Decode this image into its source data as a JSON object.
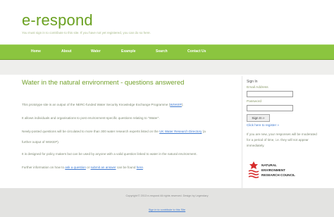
{
  "header": {
    "title": "e-respond",
    "tagline": "You must sign in to contribute to this site. If you have not yet registered, you can do so here."
  },
  "nav": {
    "items": [
      {
        "label": "Home"
      },
      {
        "label": "About"
      },
      {
        "label": "Water"
      },
      {
        "label": "Example"
      },
      {
        "label": "Search"
      },
      {
        "label": "Contact Us"
      }
    ]
  },
  "main": {
    "title": "Water in the natural environment - questions answered",
    "p1_text": "This prototype site is an output of the NERC-funded Water Security Knowledge Exchange Programme (",
    "p1_link": "WSKEP",
    "p1_end": ").",
    "p2": "It allows individuals and organisations to post environment-specific questions relating to \"Water\".",
    "p3_text": "Newly-posted questions will be circulated to more than 300 water research experts listed on the ",
    "p3_link": "UK Water Research Directory",
    "p3_end": " (a",
    "p4": "further output of WSKEP).",
    "p5": "It is designed for policy makers but can be used by anyone with a valid question linked to water in the natural environment.",
    "p6_a": "Further information on how to ",
    "p6_link1": "ask a question",
    "p6_b": " or ",
    "p6_link2": "submit an answer",
    "p6_c": " can be found ",
    "p6_link3": "here",
    "p6_d": "."
  },
  "sidebar": {
    "title": "Sign In",
    "email_label": "Email Address",
    "password_label": "Password",
    "button": "Sign In »",
    "register": "Click here to register »",
    "note": "If you are new, your responses will be moderated for a period of time, i.e. they will not appear immediately.",
    "logo_lines": [
      "NATURAL",
      "ENVIRONMENT",
      "RESEARCH COUNCIL"
    ]
  },
  "footer": {
    "copyright": "Copyright © 2013 e-respond All rights reserved. Design by Legendary",
    "note": "Sign in to contribute to this Site"
  },
  "colors": {
    "accent": "#8bc53f",
    "brand": "#6aa121",
    "link": "#3f7ad0",
    "logo": "#d62b2b"
  }
}
